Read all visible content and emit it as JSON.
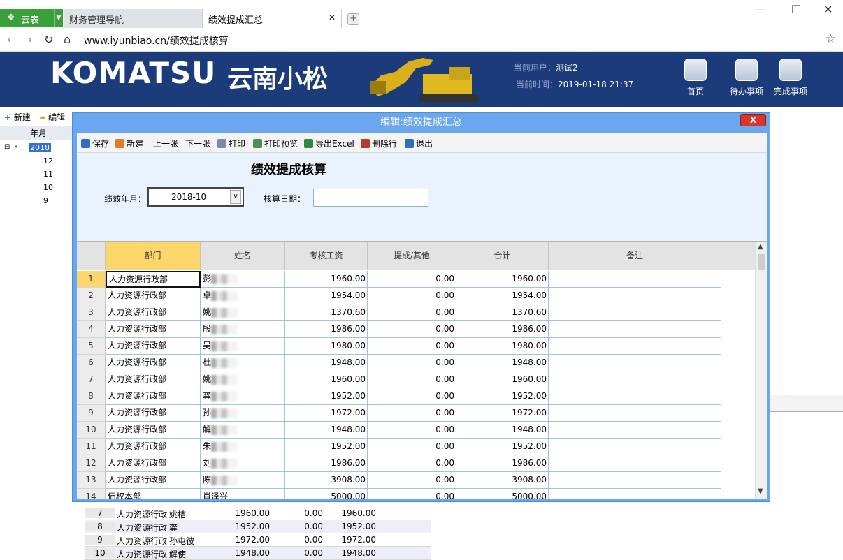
{
  "browser": {
    "app_name": "云表",
    "tabs": [
      {
        "label": "财务管理导航"
      },
      {
        "label": "绩效提成汇总"
      }
    ],
    "address": "www.iyunbiao.cn/绩效提成核算"
  },
  "header": {
    "brand": "KOMATSU",
    "brand_cn": "云南小松",
    "current_user_label": "当前用户：",
    "current_user": "测试2",
    "current_time_label": "当前时间：",
    "current_time": "2019-01-18 21:37",
    "buttons": [
      {
        "label": "首页",
        "icon": "home-icon"
      },
      {
        "label": "待办事项",
        "icon": "clipboard-icon"
      },
      {
        "label": "完成事项",
        "icon": "checklist-icon"
      }
    ]
  },
  "bg_page": {
    "toolbar": {
      "new": "新建",
      "edit": "编辑"
    },
    "tree": {
      "header": "年月",
      "root": "2018",
      "children": [
        "12",
        "11",
        "10",
        "9"
      ]
    },
    "rows": [
      {
        "idx": "7",
        "dept": "人力资源行政",
        "name": "姚桔",
        "base": "1960.00",
        "extra": "0.00",
        "total": "1960.00"
      },
      {
        "idx": "8",
        "dept": "人力资源行政",
        "name": "龚",
        "base": "1952.00",
        "extra": "0.00",
        "total": "1952.00"
      },
      {
        "idx": "9",
        "dept": "人力资源行政",
        "name": "孙屯彼",
        "base": "1972.00",
        "extra": "0.00",
        "total": "1972.00"
      },
      {
        "idx": "10",
        "dept": "人力资源行政",
        "name": "解使",
        "base": "1948.00",
        "extra": "0.00",
        "total": "1948.00"
      }
    ]
  },
  "dialog": {
    "title": "编辑:绩效提成汇总",
    "close": "X",
    "toolbar": [
      {
        "label": "保存",
        "icon": "save-icon",
        "color": "#2f6fc1"
      },
      {
        "label": "新建",
        "icon": "new-doc-icon",
        "color": "#e07b2a"
      },
      {
        "label": "上一张",
        "icon": "",
        "color": ""
      },
      {
        "label": "下一张",
        "icon": "",
        "color": ""
      },
      {
        "label": "打印",
        "icon": "printer-icon",
        "color": "#7b8aa8"
      },
      {
        "label": "打印预览",
        "icon": "print-preview-icon",
        "color": "#4f8f4f"
      },
      {
        "label": "导出Excel",
        "icon": "excel-icon",
        "color": "#2e8b3c"
      },
      {
        "label": "删除行",
        "icon": "delete-row-icon",
        "color": "#b33a2f"
      },
      {
        "label": "退出",
        "icon": "exit-icon",
        "color": "#2f6fc1"
      }
    ],
    "form": {
      "title": "绩效提成核算",
      "month_label": "绩效年月：",
      "month_value": "2018-10",
      "date_label": "核算日期：",
      "date_value": ""
    },
    "grid": {
      "columns": [
        "部门",
        "姓名",
        "考核工资",
        "提成/其他",
        "合计",
        "备注"
      ],
      "rows": [
        {
          "idx": "1",
          "dept": "人力资源行政部",
          "name": "彭",
          "base": "1960.00",
          "extra": "0.00",
          "total": "1960.00",
          "note": ""
        },
        {
          "idx": "2",
          "dept": "人力资源行政部",
          "name": "卓",
          "base": "1954.00",
          "extra": "0.00",
          "total": "1954.00",
          "note": ""
        },
        {
          "idx": "3",
          "dept": "人力资源行政部",
          "name": "姚",
          "base": "1370.60",
          "extra": "0.00",
          "total": "1370.60",
          "note": ""
        },
        {
          "idx": "4",
          "dept": "人力资源行政部",
          "name": "殷",
          "base": "1986.00",
          "extra": "0.00",
          "total": "1986.00",
          "note": ""
        },
        {
          "idx": "5",
          "dept": "人力资源行政部",
          "name": "吴",
          "base": "1980.00",
          "extra": "0.00",
          "total": "1980.00",
          "note": ""
        },
        {
          "idx": "6",
          "dept": "人力资源行政部",
          "name": "杜",
          "base": "1948.00",
          "extra": "0.00",
          "total": "1948.00",
          "note": ""
        },
        {
          "idx": "7",
          "dept": "人力资源行政部",
          "name": "姚",
          "base": "1960.00",
          "extra": "0.00",
          "total": "1960.00",
          "note": ""
        },
        {
          "idx": "8",
          "dept": "人力资源行政部",
          "name": "龚",
          "base": "1952.00",
          "extra": "0.00",
          "total": "1952.00",
          "note": ""
        },
        {
          "idx": "9",
          "dept": "人力资源行政部",
          "name": "孙",
          "base": "1972.00",
          "extra": "0.00",
          "total": "1972.00",
          "note": ""
        },
        {
          "idx": "10",
          "dept": "人力资源行政部",
          "name": "解",
          "base": "1948.00",
          "extra": "0.00",
          "total": "1948.00",
          "note": ""
        },
        {
          "idx": "11",
          "dept": "人力资源行政部",
          "name": "朱",
          "base": "1952.00",
          "extra": "0.00",
          "total": "1952.00",
          "note": ""
        },
        {
          "idx": "12",
          "dept": "人力资源行政部",
          "name": "刘",
          "base": "1986.00",
          "extra": "0.00",
          "total": "1986.00",
          "note": ""
        },
        {
          "idx": "13",
          "dept": "人力资源行政部",
          "name": "陈",
          "base": "3908.00",
          "extra": "0.00",
          "total": "3908.00",
          "note": ""
        },
        {
          "idx": "14",
          "dept": "债权本部",
          "name": "肖泽兴",
          "base": "5000.00",
          "extra": "0.00",
          "total": "5000.00",
          "note": ""
        }
      ]
    }
  }
}
